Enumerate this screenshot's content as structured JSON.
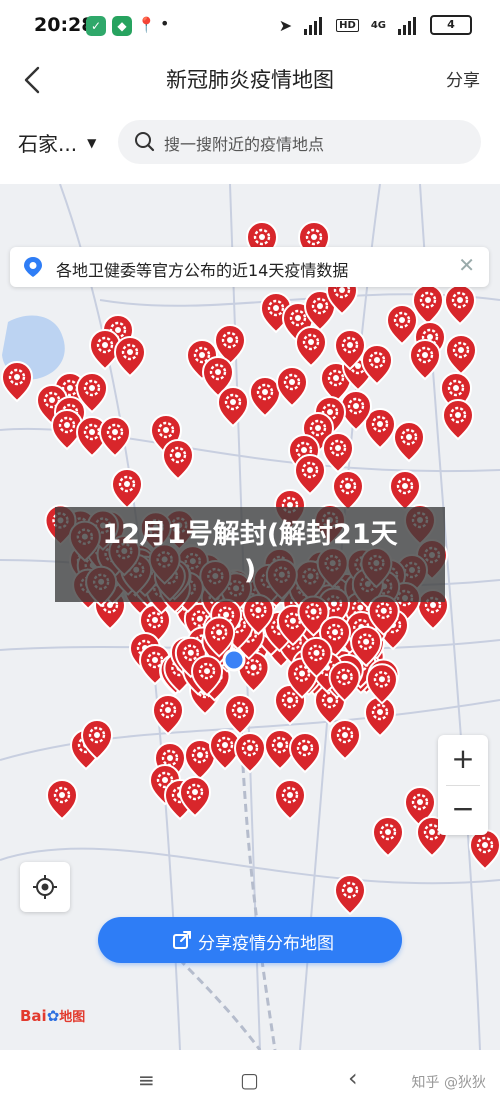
{
  "status_bar": {
    "time": "20:28",
    "network_label": "4G",
    "battery": "4"
  },
  "nav": {
    "title": "新冠肺炎疫情地图",
    "share": "分享"
  },
  "search": {
    "city": "石家...",
    "placeholder": "搜一搜附近的疫情地点"
  },
  "notice": {
    "text": "各地卫健委等官方公布的近14天疫情数据"
  },
  "overlay": {
    "line1": "12月1号解封(解封21天",
    "line2": ")"
  },
  "map_controls": {
    "zoom_in": "+",
    "zoom_out": "−"
  },
  "share_map_button": {
    "label": "分享疫情分布地图"
  },
  "map_logo": {
    "text": "Bai",
    "paw": "✿",
    "suffix": "地图"
  },
  "system_nav": {
    "menu": "≡",
    "home": "▢",
    "back": "‹"
  },
  "watermark": "知乎 @狄狄",
  "colors": {
    "accent": "#2e7df6",
    "marker": "#d8262b",
    "location_dot": "#3b82f6"
  }
}
